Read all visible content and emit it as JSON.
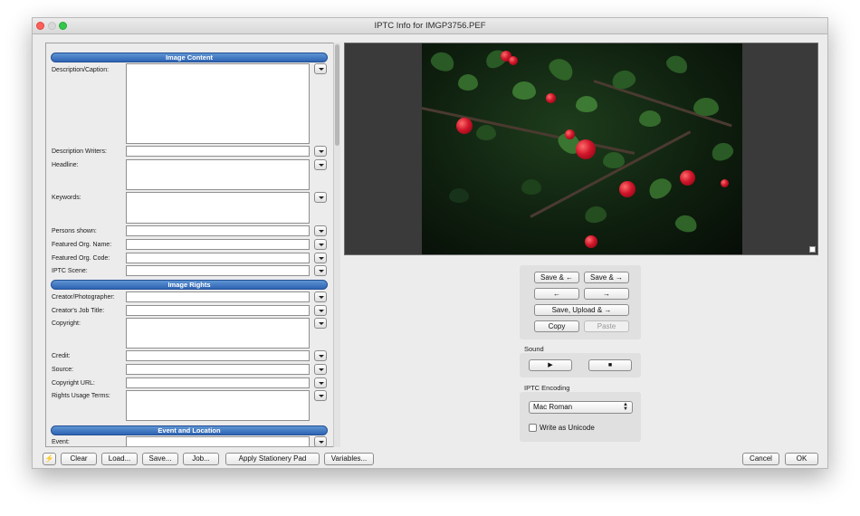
{
  "window": {
    "title": "IPTC Info for IMGP3756.PEF"
  },
  "sections": {
    "image_content": "Image Content",
    "image_rights": "Image Rights",
    "event_location": "Event and Location"
  },
  "fields": {
    "description_caption": "Description/Caption:",
    "description_writers": "Description Writers:",
    "headline": "Headline:",
    "keywords": "Keywords:",
    "persons_shown": "Persons shown:",
    "featured_org_name": "Featured Org. Name:",
    "featured_org_code": "Featured Org. Code:",
    "iptc_scene": "IPTC Scene:",
    "creator_photographer": "Creator/Photographer:",
    "creators_job_title": "Creator's Job Title:",
    "copyright": "Copyright:",
    "credit": "Credit:",
    "source": "Source:",
    "copyright_url": "Copyright URL:",
    "rights_usage_terms": "Rights Usage Terms:",
    "event": "Event:"
  },
  "controls": {
    "save_prev": "Save & ←",
    "save_next": "Save & →",
    "prev": "←",
    "next": "→",
    "save_upload_next": "Save, Upload & →",
    "copy": "Copy",
    "paste": "Paste",
    "sound_label": "Sound",
    "play": "▶",
    "stop": "■",
    "encoding_label": "IPTC Encoding",
    "encoding_value": "Mac Roman",
    "write_unicode": "Write as Unicode"
  },
  "bottom": {
    "lightning": "⚡",
    "clear": "Clear",
    "load": "Load...",
    "save": "Save...",
    "job": "Job...",
    "apply_stationery": "Apply Stationery Pad",
    "variables": "Variables...",
    "cancel": "Cancel",
    "ok": "OK"
  },
  "icons": {
    "close": "close-icon",
    "minimize": "minimize-icon",
    "maximize": "maximize-icon",
    "dropdown": "chevron-down-icon"
  }
}
